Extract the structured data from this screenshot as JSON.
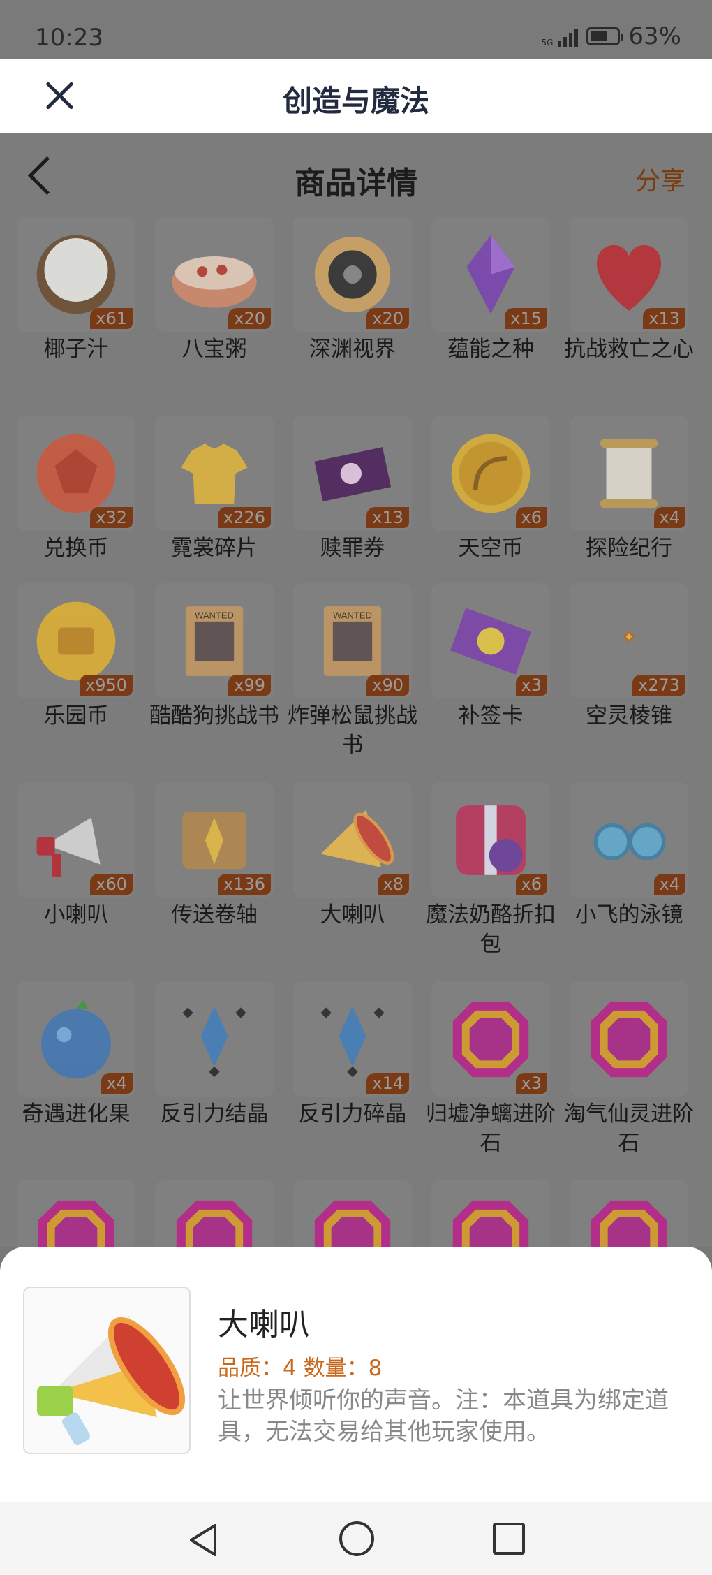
{
  "status_bar": {
    "time": "10:23",
    "network": "5G",
    "battery": "63%",
    "battery_level": 0.63
  },
  "app_bar": {
    "title": "创造与魔法"
  },
  "sub_header": {
    "title": "商品详情",
    "share": "分享"
  },
  "items": [
    {
      "name": "椰子汁",
      "count": "x61",
      "icon": "coconut-icon"
    },
    {
      "name": "八宝粥",
      "count": "x20",
      "icon": "porridge-icon"
    },
    {
      "name": "深渊视界",
      "count": "x20",
      "icon": "abyss-sun-icon"
    },
    {
      "name": "蕴能之种",
      "count": "x15",
      "icon": "purple-crystal-icon"
    },
    {
      "name": "抗战救亡之心",
      "count": "x13",
      "icon": "red-heart-icon"
    },
    {
      "name": "兑换币",
      "count": "x32",
      "icon": "red-gem-coin-icon"
    },
    {
      "name": "霓裳碎片",
      "count": "x226",
      "icon": "shirt-icon"
    },
    {
      "name": "赎罪券",
      "count": "x13",
      "icon": "purple-ticket-icon"
    },
    {
      "name": "天空币",
      "count": "x6",
      "icon": "bow-coin-icon"
    },
    {
      "name": "探险纪行",
      "count": "x4",
      "icon": "scroll-icon"
    },
    {
      "name": "乐园币",
      "count": "x950",
      "icon": "chest-coin-icon"
    },
    {
      "name": "酷酷狗挑战书",
      "count": "x99",
      "icon": "wanted-poster-icon"
    },
    {
      "name": "炸弹松鼠挑战书",
      "count": "x90",
      "icon": "wanted-poster-icon"
    },
    {
      "name": "补签卡",
      "count": "x3",
      "icon": "sign-card-icon"
    },
    {
      "name": "空灵棱锥",
      "count": "x273",
      "icon": "pyramid-icon"
    },
    {
      "name": "小喇叭",
      "count": "x60",
      "icon": "small-horn-icon"
    },
    {
      "name": "传送卷轴",
      "count": "x136",
      "icon": "teleport-scroll-icon"
    },
    {
      "name": "大喇叭",
      "count": "x8",
      "icon": "big-horn-icon"
    },
    {
      "name": "魔法奶酪折扣包",
      "count": "x6",
      "icon": "gift-box-icon"
    },
    {
      "name": "小飞的泳镜",
      "count": "x4",
      "icon": "goggles-icon"
    },
    {
      "name": "奇遇进化果",
      "count": "x4",
      "icon": "blue-fruit-icon"
    },
    {
      "name": "反引力结晶",
      "count": "",
      "icon": "antigravity-crystal-icon"
    },
    {
      "name": "反引力碎晶",
      "count": "x14",
      "icon": "antigravity-shard-icon"
    },
    {
      "name": "归墟净螭进阶石",
      "count": "x3",
      "icon": "gem-stone-icon"
    },
    {
      "name": "淘气仙灵进阶石",
      "count": "",
      "icon": "gem-stone-icon"
    },
    {
      "name": "",
      "count": "",
      "icon": "gem-stone-icon"
    },
    {
      "name": "",
      "count": "",
      "icon": "gem-stone-icon"
    },
    {
      "name": "",
      "count": "",
      "icon": "gem-stone-icon"
    },
    {
      "name": "",
      "count": "",
      "icon": "gem-stone-icon"
    },
    {
      "name": "",
      "count": "",
      "icon": "gem-stone-icon"
    }
  ],
  "detail": {
    "name": "大喇叭",
    "meta": "品质：4   数量：8",
    "description": "让世界倾听你的声音。注：本道具为绑定道具，无法交易给其他玩家使用。",
    "icon": "big-horn-icon"
  }
}
